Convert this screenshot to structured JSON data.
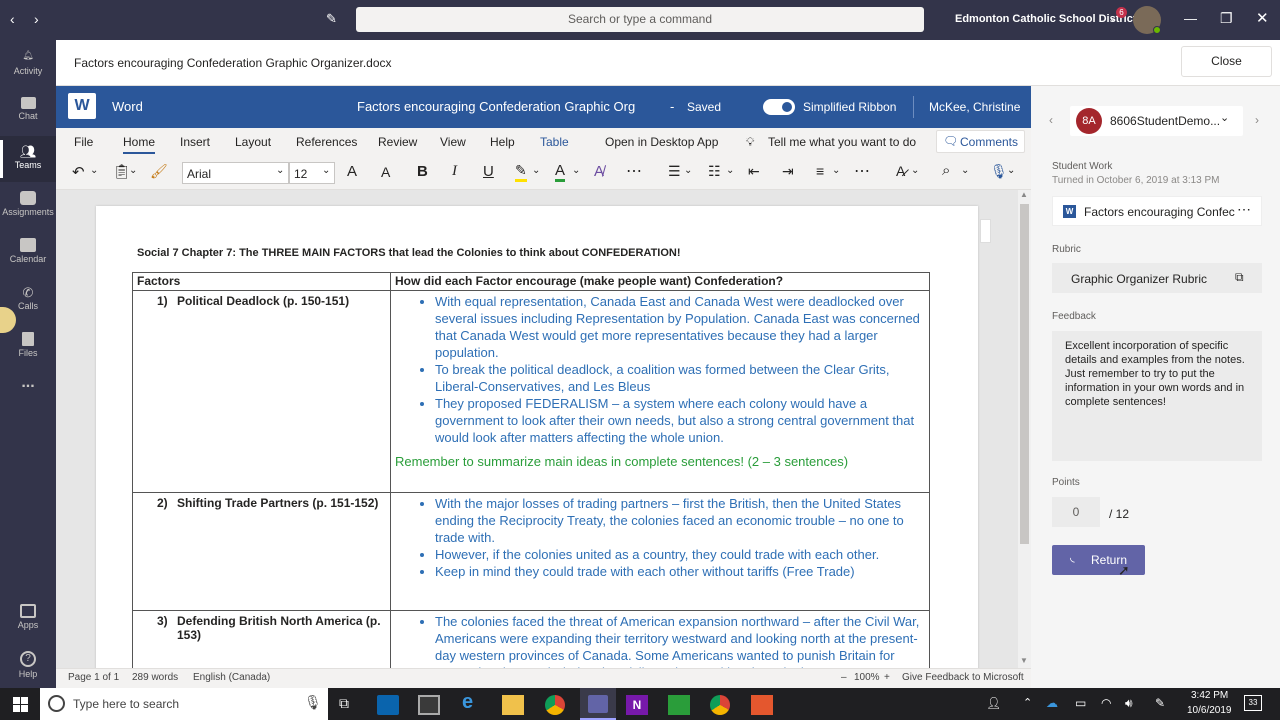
{
  "titlebar": {
    "search_placeholder": "Search or type a command",
    "org": "Edmonton Catholic School District",
    "notif_count": "6"
  },
  "rail": [
    {
      "label": "Activity",
      "icon": "bell-icon"
    },
    {
      "label": "Chat",
      "icon": "chat-icon"
    },
    {
      "label": "Teams",
      "icon": "teams-icon"
    },
    {
      "label": "Assignments",
      "icon": "assignments-icon"
    },
    {
      "label": "Calendar",
      "icon": "calendar-icon"
    },
    {
      "label": "Calls",
      "icon": "phone-icon"
    },
    {
      "label": "Files",
      "icon": "files-icon"
    },
    {
      "label": "...",
      "icon": "more-icon"
    },
    {
      "label": "Apps",
      "icon": "apps-icon"
    },
    {
      "label": "Help",
      "icon": "help-icon"
    }
  ],
  "docheader": {
    "filename": "Factors encouraging Confederation Graphic Organizer.docx",
    "close_label": "Close"
  },
  "wordbar": {
    "app": "Word",
    "doc_title": "Factors encouraging Confederation Graphic Org",
    "separator": "-",
    "status": "Saved",
    "ribbon_toggle": "Simplified Ribbon",
    "user": "McKee, Christine"
  },
  "ribbon": {
    "tabs": [
      "File",
      "Home",
      "Insert",
      "Layout",
      "References",
      "Review",
      "View",
      "Help",
      "Table"
    ],
    "open_desktop": "Open in Desktop App",
    "tell_me": "Tell me what you want to do",
    "comments": "Comments",
    "font": "Arial",
    "size": "12"
  },
  "doc": {
    "heading": "Social 7 Chapter 7: The THREE MAIN FACTORS that lead the Colonies to think about CONFEDERATION!",
    "col1": "Factors",
    "col2": "How did each Factor encourage (make people want) Confederation?",
    "rows": [
      {
        "num": "1)",
        "factor": "Political Deadlock (p. 150-151)",
        "bullets": [
          "With equal representation, Canada East and Canada West were deadlocked over several issues including Representation by Population. Canada East was concerned that Canada West would get more representatives because they had a larger population.",
          "To break the political deadlock, a coalition was formed between the Clear Grits, Liberal-Conservatives, and Les Bleus",
          "They proposed FEDERALISM – a system where each colony would have a government to look after their own needs, but also a strong central government that would look after matters affecting the whole union."
        ],
        "note": "Remember to summarize main ideas in complete sentences! (2 – 3 sentences)"
      },
      {
        "num": "2)",
        "factor": "Shifting Trade Partners (p. 151-152)",
        "bullets": [
          "With the major losses of trading partners – first the British, then the United States ending the Reciprocity Treaty, the colonies faced an economic trouble – no one to trade with.",
          "However, if the colonies united as a country, they could trade with each other.",
          "Keep in mind they could trade with each other without tariffs (Free Trade)"
        ]
      },
      {
        "num": "3)",
        "factor": "Defending British North America (p. 153)",
        "bullets": [
          "The colonies faced the threat of American expansion northward – after the Civil War, Americans were expanding their territory westward and looking north at the present-day western provinces of Canada. Some Americans wanted to punish Britain for supporting the South during the Civil War by attacking the colonies."
        ]
      }
    ]
  },
  "status": {
    "page": "Page 1 of 1",
    "words": "289 words",
    "lang": "English (Canada)",
    "zoom_minus": "–",
    "zoom": "100%",
    "zoom_plus": "+",
    "feedback": "Give Feedback to Microsoft"
  },
  "panel": {
    "student_initials": "8A",
    "student_name": "8606StudentDemo...",
    "student_work_label": "Student Work",
    "turned_in": "Turned in October 6, 2019 at 3:13 PM",
    "file_name": "Factors encouraging Confec",
    "rubric_label": "Rubric",
    "rubric_name": "Graphic Organizer Rubric",
    "feedback_label": "Feedback",
    "feedback_text": "Excellent incorporation of specific details and examples from the notes. Just remember to try to put the information in your own words and in complete sentences!",
    "points_label": "Points",
    "points_value": "0",
    "points_max": "/ 12",
    "return_label": "Return"
  },
  "taskbar": {
    "search_placeholder": "Type here to search",
    "time": "3:42 PM",
    "date": "10/6/2019",
    "notif": "33"
  },
  "colors": {
    "teams_bg": "#33344a",
    "word_blue": "#2b579a",
    "accent": "#6264a7",
    "doc_blue": "#2e6fb5",
    "note_green": "#2a9d3a"
  }
}
